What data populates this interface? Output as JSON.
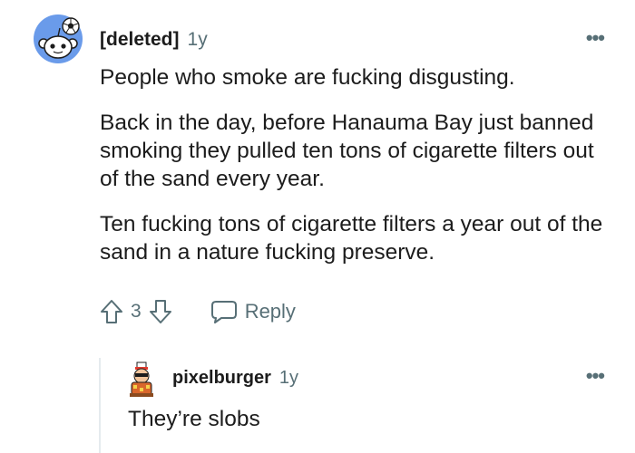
{
  "comment": {
    "username": "[deleted]",
    "timestamp": "1y",
    "more_label": "•••",
    "paragraphs": [
      "People who smoke are fucking disgusting.",
      "Back in the day, before Hanauma Bay just banned smoking they pulled ten tons of cigarette filters out of the sand every year.",
      "Ten fucking tons of cigarette filters a year out of the sand in a nature fucking preserve."
    ],
    "vote_count": "3",
    "reply_label": "Reply",
    "avatar_icon": "snoo-avatar-icon"
  },
  "reply": {
    "username": "pixelburger",
    "timestamp": "1y",
    "more_label": "•••",
    "text": "They’re slobs",
    "avatar_icon": "pixel-avatar-icon"
  },
  "colors": {
    "text": "#1c1c1c",
    "meta": "#576f76",
    "thread_line": "#e5ebee",
    "avatar_bg": "#5c8fe6"
  }
}
